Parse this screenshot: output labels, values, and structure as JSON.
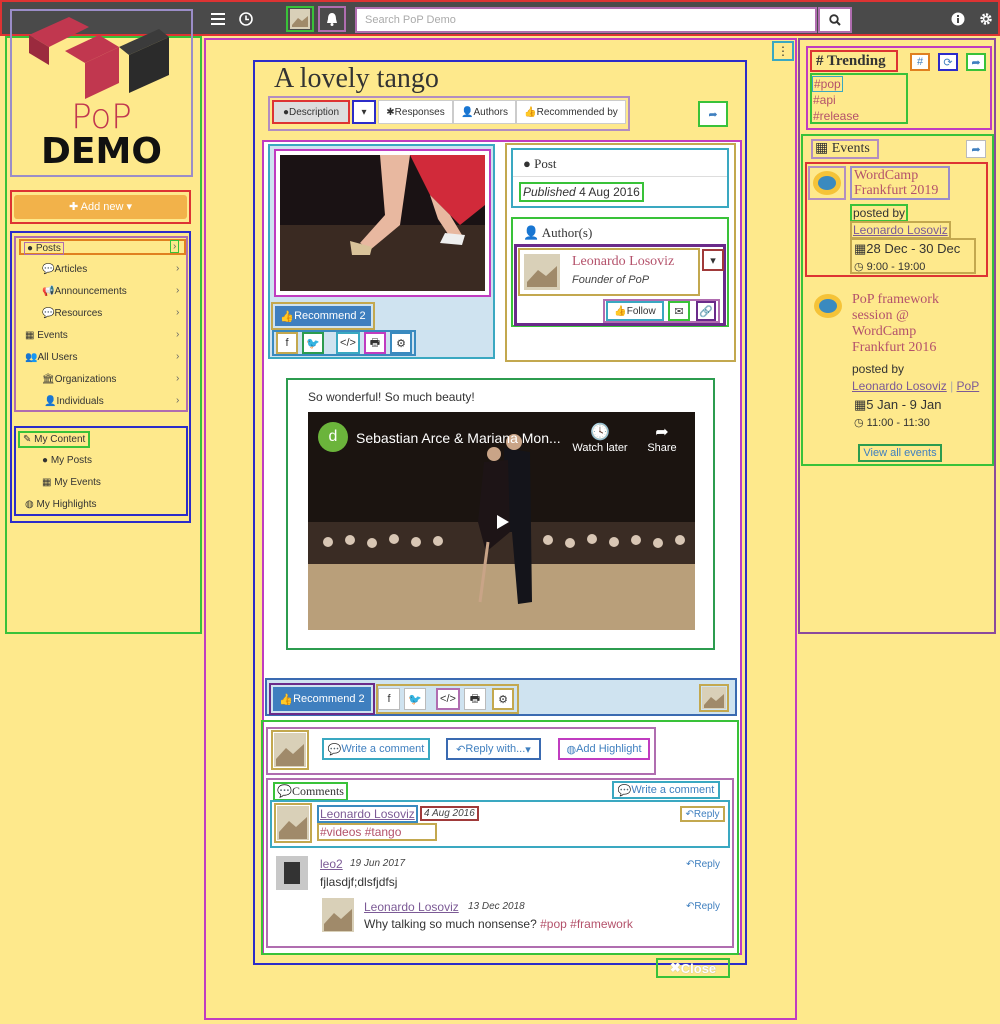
{
  "search": {
    "placeholder": "Search PoP Demo"
  },
  "logo": {
    "line1": "PoP",
    "line2": "DEMO"
  },
  "sidebar": {
    "add_new": "Add new",
    "items": [
      {
        "label": "Posts",
        "level": 1
      },
      {
        "label": "Articles",
        "level": 2
      },
      {
        "label": "Announcements",
        "level": 2
      },
      {
        "label": "Resources",
        "level": 2
      },
      {
        "label": "Events",
        "level": 1
      },
      {
        "label": "All Users",
        "level": 1
      },
      {
        "label": "Organizations",
        "level": 2
      },
      {
        "label": "Individuals",
        "level": 2
      }
    ],
    "my": [
      {
        "label": "My Content"
      },
      {
        "label": "My Posts"
      },
      {
        "label": "My Events"
      },
      {
        "label": "My Highlights"
      }
    ]
  },
  "post": {
    "title": "A lovely tango",
    "tabs": {
      "description": "Description",
      "responses": "Responses",
      "authors": "Authors",
      "recommended_by": "Recommended by"
    },
    "recommend_label": "Recommend 2",
    "meta_heading": "Post",
    "published_label": "Published",
    "published_date": "4 Aug 2016",
    "authors_heading": "Author(s)",
    "author_name": "Leonardo Losoviz",
    "author_role": "Founder of PoP",
    "follow_label": "Follow",
    "content_text": "So wonderful! So much beauty!",
    "video": {
      "channel_letter": "d",
      "title": "Sebastian Arce & Mariana Mon...",
      "watch_later": "Watch later",
      "share": "Share"
    }
  },
  "actions": {
    "write_comment": "Write a comment",
    "reply_with": "Reply with...",
    "add_highlight": "Add Highlight"
  },
  "comments": {
    "heading": "Comments",
    "write_comment": "Write a comment",
    "reply_label": "Reply",
    "items": [
      {
        "author": "Leonardo Losoviz",
        "date": "4 Aug 2016",
        "text": "#videos #tango"
      },
      {
        "author": "leo2",
        "date": "19 Jun 2017",
        "text": "fjlasdjf;dlsfjdfsj"
      },
      {
        "author": "Leonardo Losoviz",
        "date": "13 Dec 2018",
        "text": "Why talking so much nonsense?",
        "tags": "#pop #framework"
      }
    ]
  },
  "close_label": "Close",
  "trending": {
    "heading": "Trending",
    "tags": [
      "#pop",
      "#api",
      "#release"
    ]
  },
  "events": {
    "heading": "Events",
    "items": [
      {
        "title": "WordCamp Frankfurt 2019",
        "posted_by": "posted by",
        "author": "Leonardo Losoviz",
        "dates": "28 Dec - 30 Dec",
        "time": "9:00 - 19:00"
      },
      {
        "title": "PoP framework session @ WordCamp Frankfurt 2016",
        "posted_by": "posted by",
        "author": "Leonardo Losoviz",
        "author2": "PoP",
        "dates": "5 Jan - 9 Jan",
        "time": "11:00 - 11:30"
      }
    ],
    "view_all": "View all events"
  },
  "colors": {
    "page_bg": "#fee98c",
    "topbar": "#4a4a4a",
    "accent_blue": "#3f7fbf",
    "link_red": "#b4526b",
    "orange_button": "#f2b24a"
  }
}
